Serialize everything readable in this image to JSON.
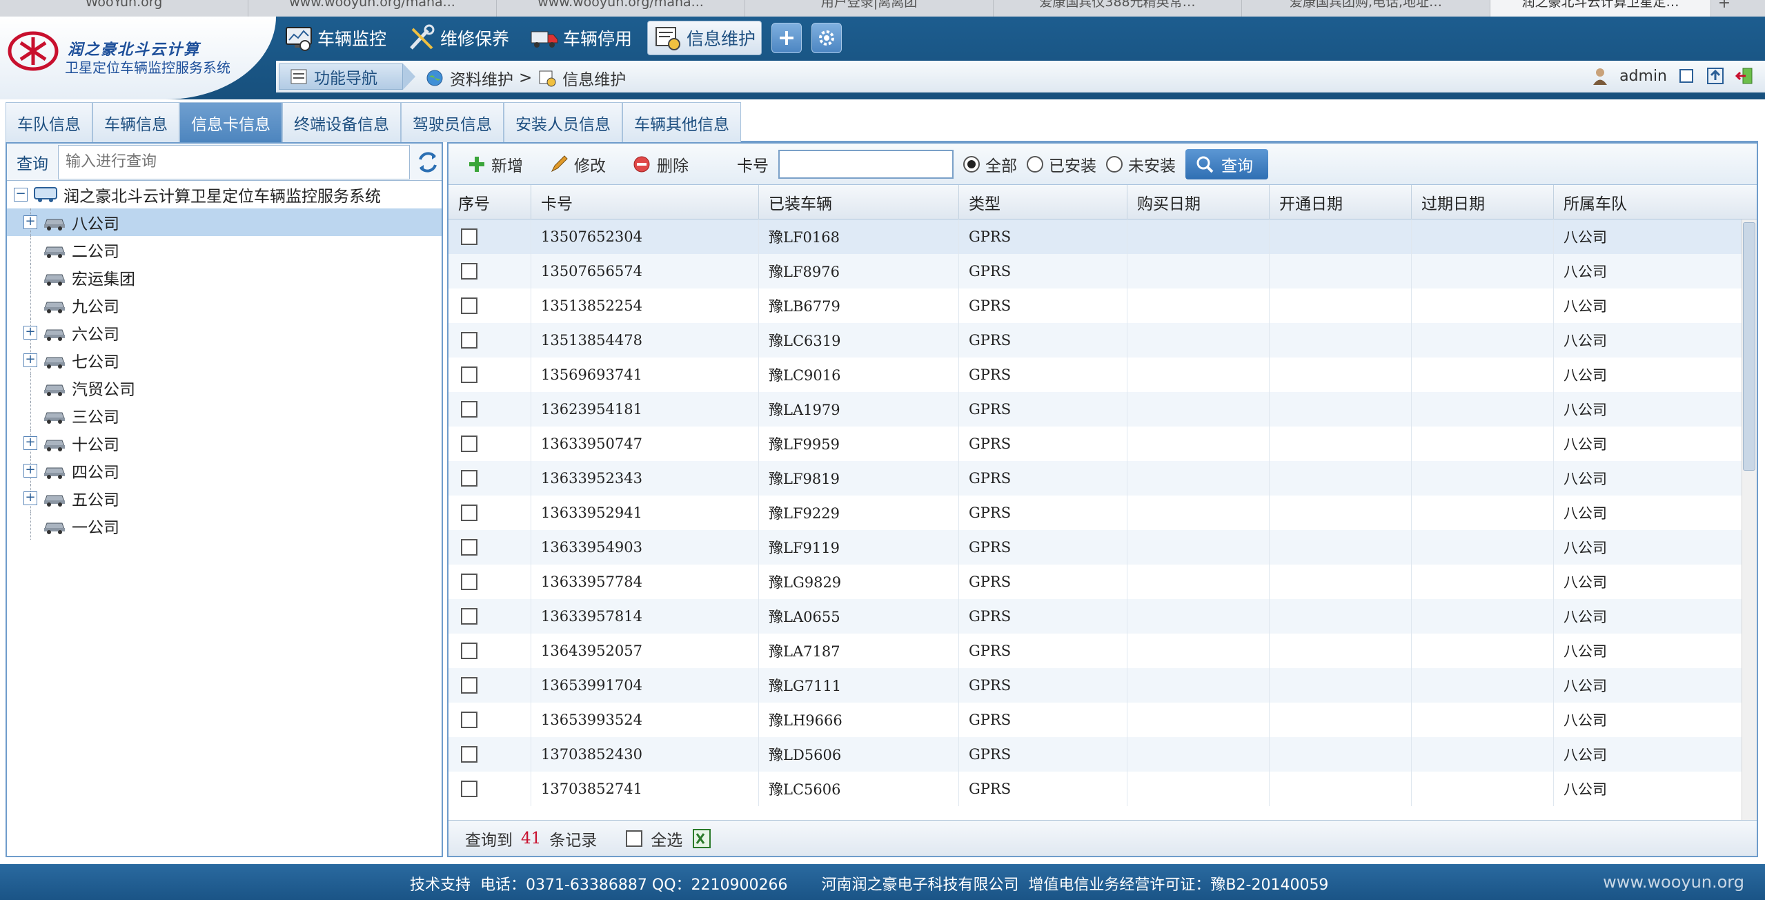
{
  "browser_tabs": [
    "WooYun.org",
    "www.wooyun.org/mana...",
    "www.wooyun.org/mana...",
    "用户登录|离离团",
    "爱康国宾仪388元精英常…",
    "爱康国宾团购,电话,地址…",
    "润之豪北斗云计算卫星定…"
  ],
  "logo": {
    "line1": "润之豪北斗云计算",
    "line2": "卫星定位车辆监控服务系统"
  },
  "topnav": [
    {
      "label": "车辆监控",
      "icon": "monitor-icon"
    },
    {
      "label": "维修保养",
      "icon": "tools-icon"
    },
    {
      "label": "车辆停用",
      "icon": "truck-icon"
    },
    {
      "label": "信息维护",
      "icon": "info-settings-icon"
    }
  ],
  "subbar": {
    "func_nav": "功能导航",
    "crumb1": "资料维护",
    "crumb_sep": ">",
    "crumb2": "信息维护",
    "user": "admin"
  },
  "tabs": [
    "车队信息",
    "车辆信息",
    "信息卡信息",
    "终端设备信息",
    "驾驶员信息",
    "安装人员信息",
    "车辆其他信息"
  ],
  "left": {
    "search_label": "查询",
    "search_placeholder": "输入进行查询",
    "root": "润之豪北斗云计算卫星定位车辆监控服务系统",
    "nodes": [
      {
        "label": "八公司",
        "expandable": true
      },
      {
        "label": "二公司",
        "expandable": false
      },
      {
        "label": "宏运集团",
        "expandable": false
      },
      {
        "label": "九公司",
        "expandable": false
      },
      {
        "label": "六公司",
        "expandable": true
      },
      {
        "label": "七公司",
        "expandable": true
      },
      {
        "label": "汽贸公司",
        "expandable": false
      },
      {
        "label": "三公司",
        "expandable": false
      },
      {
        "label": "十公司",
        "expandable": true
      },
      {
        "label": "四公司",
        "expandable": true
      },
      {
        "label": "五公司",
        "expandable": true
      },
      {
        "label": "一公司",
        "expandable": false
      }
    ]
  },
  "toolbar": {
    "add": "新增",
    "edit": "修改",
    "delete": "删除",
    "card_label": "卡号",
    "card_value": "",
    "radio_all": "全部",
    "radio_installed": "已安装",
    "radio_not_installed": "未安装",
    "query": "查询"
  },
  "grid": {
    "headers": [
      "序号",
      "卡号",
      "已装车辆",
      "类型",
      "购买日期",
      "开通日期",
      "过期日期",
      "所属车队"
    ],
    "rows": [
      [
        "13507652304",
        "豫LF0168",
        "GPRS",
        "",
        "",
        "",
        "八公司"
      ],
      [
        "13507656574",
        "豫LF8976",
        "GPRS",
        "",
        "",
        "",
        "八公司"
      ],
      [
        "13513852254",
        "豫LB6779",
        "GPRS",
        "",
        "",
        "",
        "八公司"
      ],
      [
        "13513854478",
        "豫LC6319",
        "GPRS",
        "",
        "",
        "",
        "八公司"
      ],
      [
        "13569693741",
        "豫LC9016",
        "GPRS",
        "",
        "",
        "",
        "八公司"
      ],
      [
        "13623954181",
        "豫LA1979",
        "GPRS",
        "",
        "",
        "",
        "八公司"
      ],
      [
        "13633950747",
        "豫LF9959",
        "GPRS",
        "",
        "",
        "",
        "八公司"
      ],
      [
        "13633952343",
        "豫LF9819",
        "GPRS",
        "",
        "",
        "",
        "八公司"
      ],
      [
        "13633952941",
        "豫LF9229",
        "GPRS",
        "",
        "",
        "",
        "八公司"
      ],
      [
        "13633954903",
        "豫LF9119",
        "GPRS",
        "",
        "",
        "",
        "八公司"
      ],
      [
        "13633957784",
        "豫LG9829",
        "GPRS",
        "",
        "",
        "",
        "八公司"
      ],
      [
        "13633957814",
        "豫LA0655",
        "GPRS",
        "",
        "",
        "",
        "八公司"
      ],
      [
        "13643952057",
        "豫LA7187",
        "GPRS",
        "",
        "",
        "",
        "八公司"
      ],
      [
        "13653991704",
        "豫LG7111",
        "GPRS",
        "",
        "",
        "",
        "八公司"
      ],
      [
        "13653993524",
        "豫LH9666",
        "GPRS",
        "",
        "",
        "",
        "八公司"
      ],
      [
        "13703852430",
        "豫LD5606",
        "GPRS",
        "",
        "",
        "",
        "八公司"
      ],
      [
        "13703852741",
        "豫LC5606",
        "GPRS",
        "",
        "",
        "",
        "八公司"
      ]
    ],
    "footer_prefix": "查询到",
    "footer_count": "41",
    "footer_suffix": "条记录",
    "select_all": "全选"
  },
  "footer": {
    "text": "技术支持  电话：0371-63386887 QQ：2210900266       河南润之豪电子科技有限公司  增值电信业务经营许可证：豫B2-20140059",
    "watermark": "www.wooyun.org"
  }
}
